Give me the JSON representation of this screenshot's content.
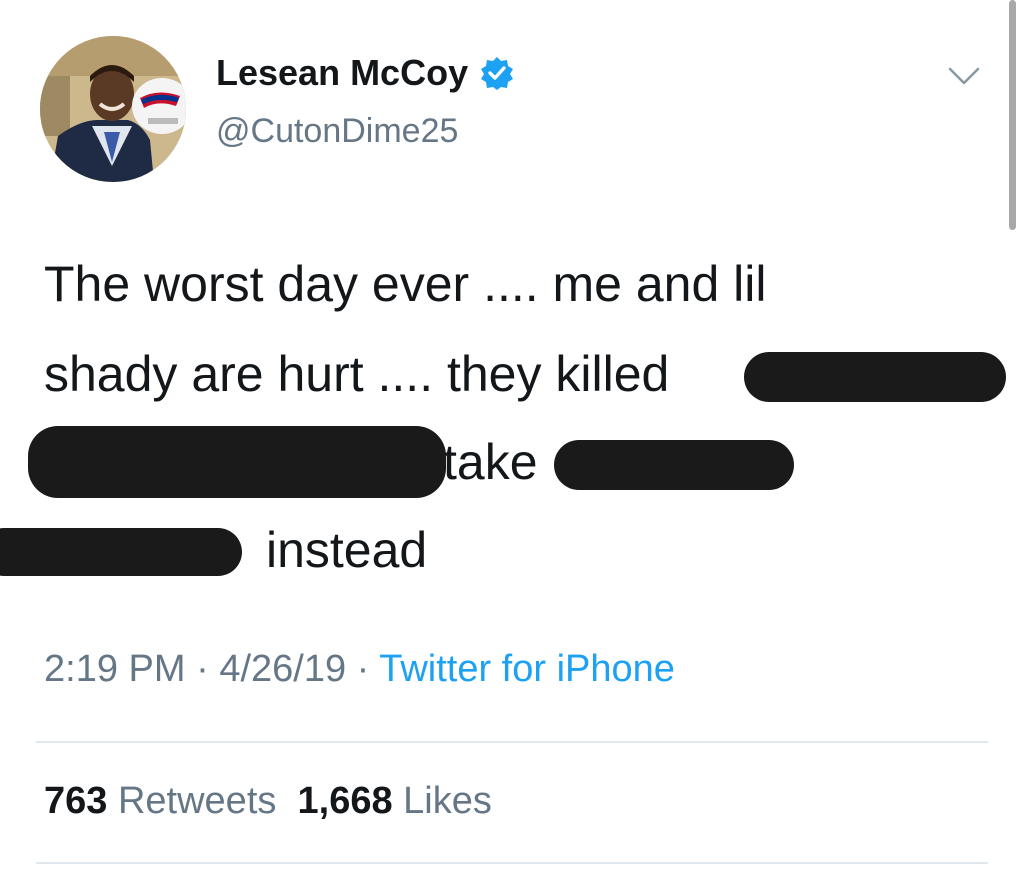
{
  "author": {
    "display_name": "Lesean McCoy",
    "handle": "@CutonDime25",
    "avatar_icon": "profile-photo",
    "verified_icon": "verified-badge-icon",
    "verified_color": "#1da1f2"
  },
  "menu_icon": "chevron-down-icon",
  "tweet": {
    "lines": [
      "The worst day ever .... me and lil",
      "shady are hurt .... they killed",
      "take",
      "instead"
    ]
  },
  "meta": {
    "time": "2:19 PM",
    "separator": " · ",
    "date": "4/26/19",
    "source": "Twitter for iPhone"
  },
  "stats": {
    "retweets_count": "763",
    "retweets_label": "Retweets",
    "likes_count": "1,668",
    "likes_label": "Likes"
  },
  "colors": {
    "text": "#14171a",
    "secondary": "#657786",
    "link": "#1da1f2",
    "redaction": "#1a1a1a",
    "divider": "#e1e8ed"
  }
}
